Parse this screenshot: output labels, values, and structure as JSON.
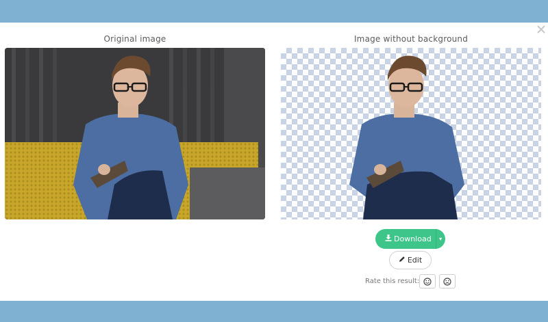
{
  "colors": {
    "frame": "#7fb1d3",
    "download": "#3ec58a",
    "checker": "#c9d3e6"
  },
  "captions": {
    "original": "Original image",
    "result": "Image without background"
  },
  "actions": {
    "download_label": "Download",
    "edit_label": "Edit"
  },
  "rating": {
    "label": "Rate this result:",
    "icons": [
      "smile-icon",
      "frown-icon"
    ]
  },
  "icons": {
    "close": "close-icon",
    "download": "download-icon",
    "caret": "chevron-down-icon",
    "edit": "pencil-icon"
  }
}
